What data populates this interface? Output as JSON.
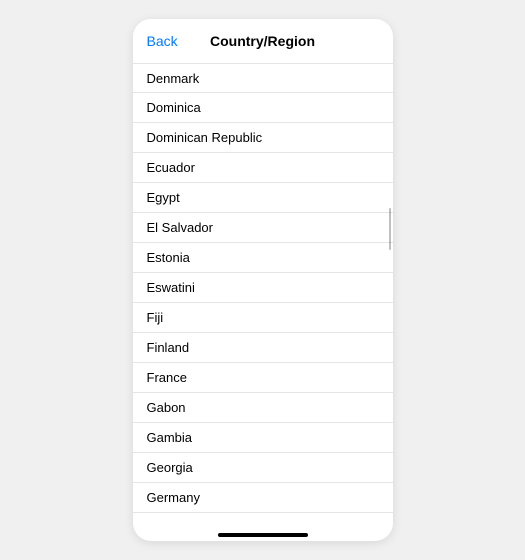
{
  "header": {
    "back_label": "Back",
    "title": "Country/Region"
  },
  "countries": [
    "Denmark",
    "Dominica",
    "Dominican Republic",
    "Ecuador",
    "Egypt",
    "El Salvador",
    "Estonia",
    "Eswatini",
    "Fiji",
    "Finland",
    "France",
    "Gabon",
    "Gambia",
    "Georgia",
    "Germany"
  ]
}
